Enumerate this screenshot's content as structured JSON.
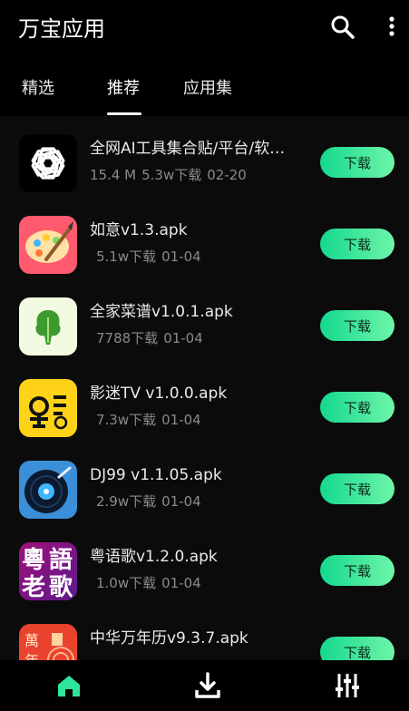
{
  "header": {
    "title": "万宝应用"
  },
  "tabs": [
    {
      "label": "精选",
      "active": false
    },
    {
      "label": "推荐",
      "active": true
    },
    {
      "label": "应用集",
      "active": false
    }
  ],
  "apps": [
    {
      "name": "全网AI工具集合贴/平台/软…",
      "size": "15.4 M",
      "downloads": "5.3w下载",
      "date": "02-20",
      "button": "下载",
      "icon": "openai-knot-icon"
    },
    {
      "name": "如意v1.3.apk",
      "size": "",
      "downloads": "5.1w下载",
      "date": "01-04",
      "button": "下载",
      "icon": "paint-palette-icon"
    },
    {
      "name": "全家菜谱v1.0.1.apk",
      "size": "",
      "downloads": "7788下载",
      "date": "01-04",
      "button": "下载",
      "icon": "vegetable-icon"
    },
    {
      "name": "影迷TV v1.0.0.apk",
      "size": "",
      "downloads": "7.3w下载",
      "date": "01-04",
      "button": "下载",
      "icon": "yingmi-logo-icon"
    },
    {
      "name": "DJ99 v1.1.05.apk",
      "size": "",
      "downloads": "2.9w下载",
      "date": "01-04",
      "button": "下载",
      "icon": "vinyl-record-icon"
    },
    {
      "name": "粤语歌v1.2.0.apk",
      "size": "",
      "downloads": "1.0w下载",
      "date": "01-04",
      "button": "下载",
      "icon": "cantonese-song-icon",
      "icon_text": [
        "粵",
        "語",
        "老",
        "歌"
      ]
    },
    {
      "name": "中华万年历v9.3.7.apk",
      "size": "",
      "downloads": "",
      "date": "",
      "button": "下载",
      "icon": "calendar-icon",
      "icon_text": [
        "萬",
        "年"
      ]
    }
  ],
  "bottom_nav": [
    {
      "icon": "home-icon",
      "active": true
    },
    {
      "icon": "download-icon",
      "active": false
    },
    {
      "icon": "sliders-icon",
      "active": false
    }
  ],
  "colors": {
    "accent_start": "#14d88f",
    "accent_end": "#6ef5a8",
    "background": "#0b0b0b"
  }
}
